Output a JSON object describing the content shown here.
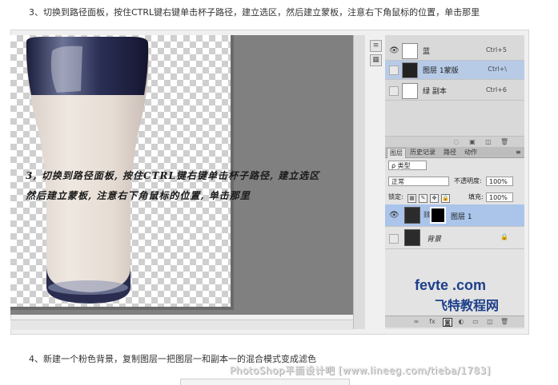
{
  "steps": {
    "step3": "3、切换到路径面板，按住CTRL键右键单击杯子路径，建立选区，然后建立蒙板，注意右下角鼠标的位置，单击那里",
    "step4": "4、新建一个粉色背景，复制图层一把图层一和副本一的混合模式变成滤色"
  },
  "overlay": {
    "line1": "3, 切换到路径面板, 按住CTRL键右键单击杯子路径, 建立选区",
    "line2": "然后建立蒙板, 注意右下角鼠标的位置, 单击那里"
  },
  "channels": {
    "rows": [
      {
        "name": "蓝",
        "shortcut": "Ctrl+5",
        "visible": true,
        "selected": false
      },
      {
        "name": "图层 1蒙版",
        "shortcut": "Ctrl+\\",
        "visible": false,
        "selected": true
      },
      {
        "name": "绿 副本",
        "shortcut": "Ctrl+6",
        "visible": false,
        "selected": false
      }
    ]
  },
  "layers_panel": {
    "tabs": [
      "图层",
      "历史记录",
      "路径",
      "动作"
    ],
    "active_tab": "图层",
    "filter_label": "ρ 类型",
    "blend_mode": "正常",
    "opacity_label": "不透明度:",
    "opacity_value": "100%",
    "lock_label": "锁定:",
    "fill_label": "填充:",
    "fill_value": "100%",
    "layers": [
      {
        "name": "图层 1",
        "selected": true,
        "visible": true,
        "has_mask": true
      },
      {
        "name": "背景",
        "selected": false,
        "visible": false,
        "locked": true
      }
    ]
  },
  "watermark": {
    "site": "fevte .com",
    "brand": "飞特教程网",
    "footer": "PhotoShop平面设计吧 [www.lineeg.com/tieba/1783]"
  },
  "colors": {
    "selected_row": "#aac4ea",
    "brand_blue": "#1d3f8a"
  }
}
